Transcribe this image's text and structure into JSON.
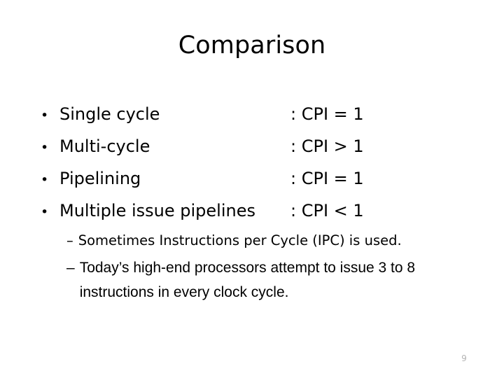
{
  "slide": {
    "title": "Comparison",
    "background_color": "#ffffff",
    "text_color": "#000000",
    "page_number": "9",
    "page_number_color": "#b3b3b3"
  },
  "bullets": {
    "marker": "•",
    "items": [
      {
        "label": "Single cycle",
        "value": ": CPI = 1"
      },
      {
        "label": "Multi-cycle",
        "value": ": CPI > 1"
      },
      {
        "label": "Pipelining",
        "value": ": CPI = 1"
      },
      {
        "label": "Multiple issue pipelines",
        "value": ": CPI < 1"
      }
    ]
  },
  "sub_bullets": {
    "marker": "–",
    "items": [
      {
        "text": "Sometimes Instructions per Cycle (IPC) is used."
      },
      {
        "text": "Today’s high-end processors attempt to issue 3 to 8 instructions in every clock cycle."
      }
    ]
  }
}
